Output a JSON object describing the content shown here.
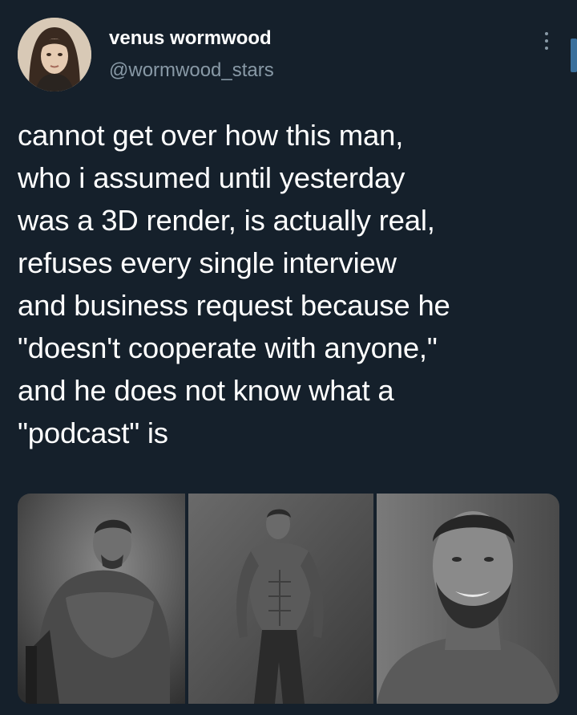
{
  "user": {
    "display_name": "venus wormwood",
    "handle": "@wormwood_stars"
  },
  "tweet": {
    "text": "cannot get over how this man,\nwho i assumed until yesterday\nwas a 3D render, is actually real,\nrefuses every single interview\nand business request because he\n\"doesn't cooperate with anyone,\"\nand he does not know what a\n\"podcast\" is"
  },
  "icons": {
    "more": "more-vertical-icon"
  },
  "colors": {
    "background": "#15202b",
    "text": "#ffffff",
    "secondary_text": "#8899a6"
  }
}
